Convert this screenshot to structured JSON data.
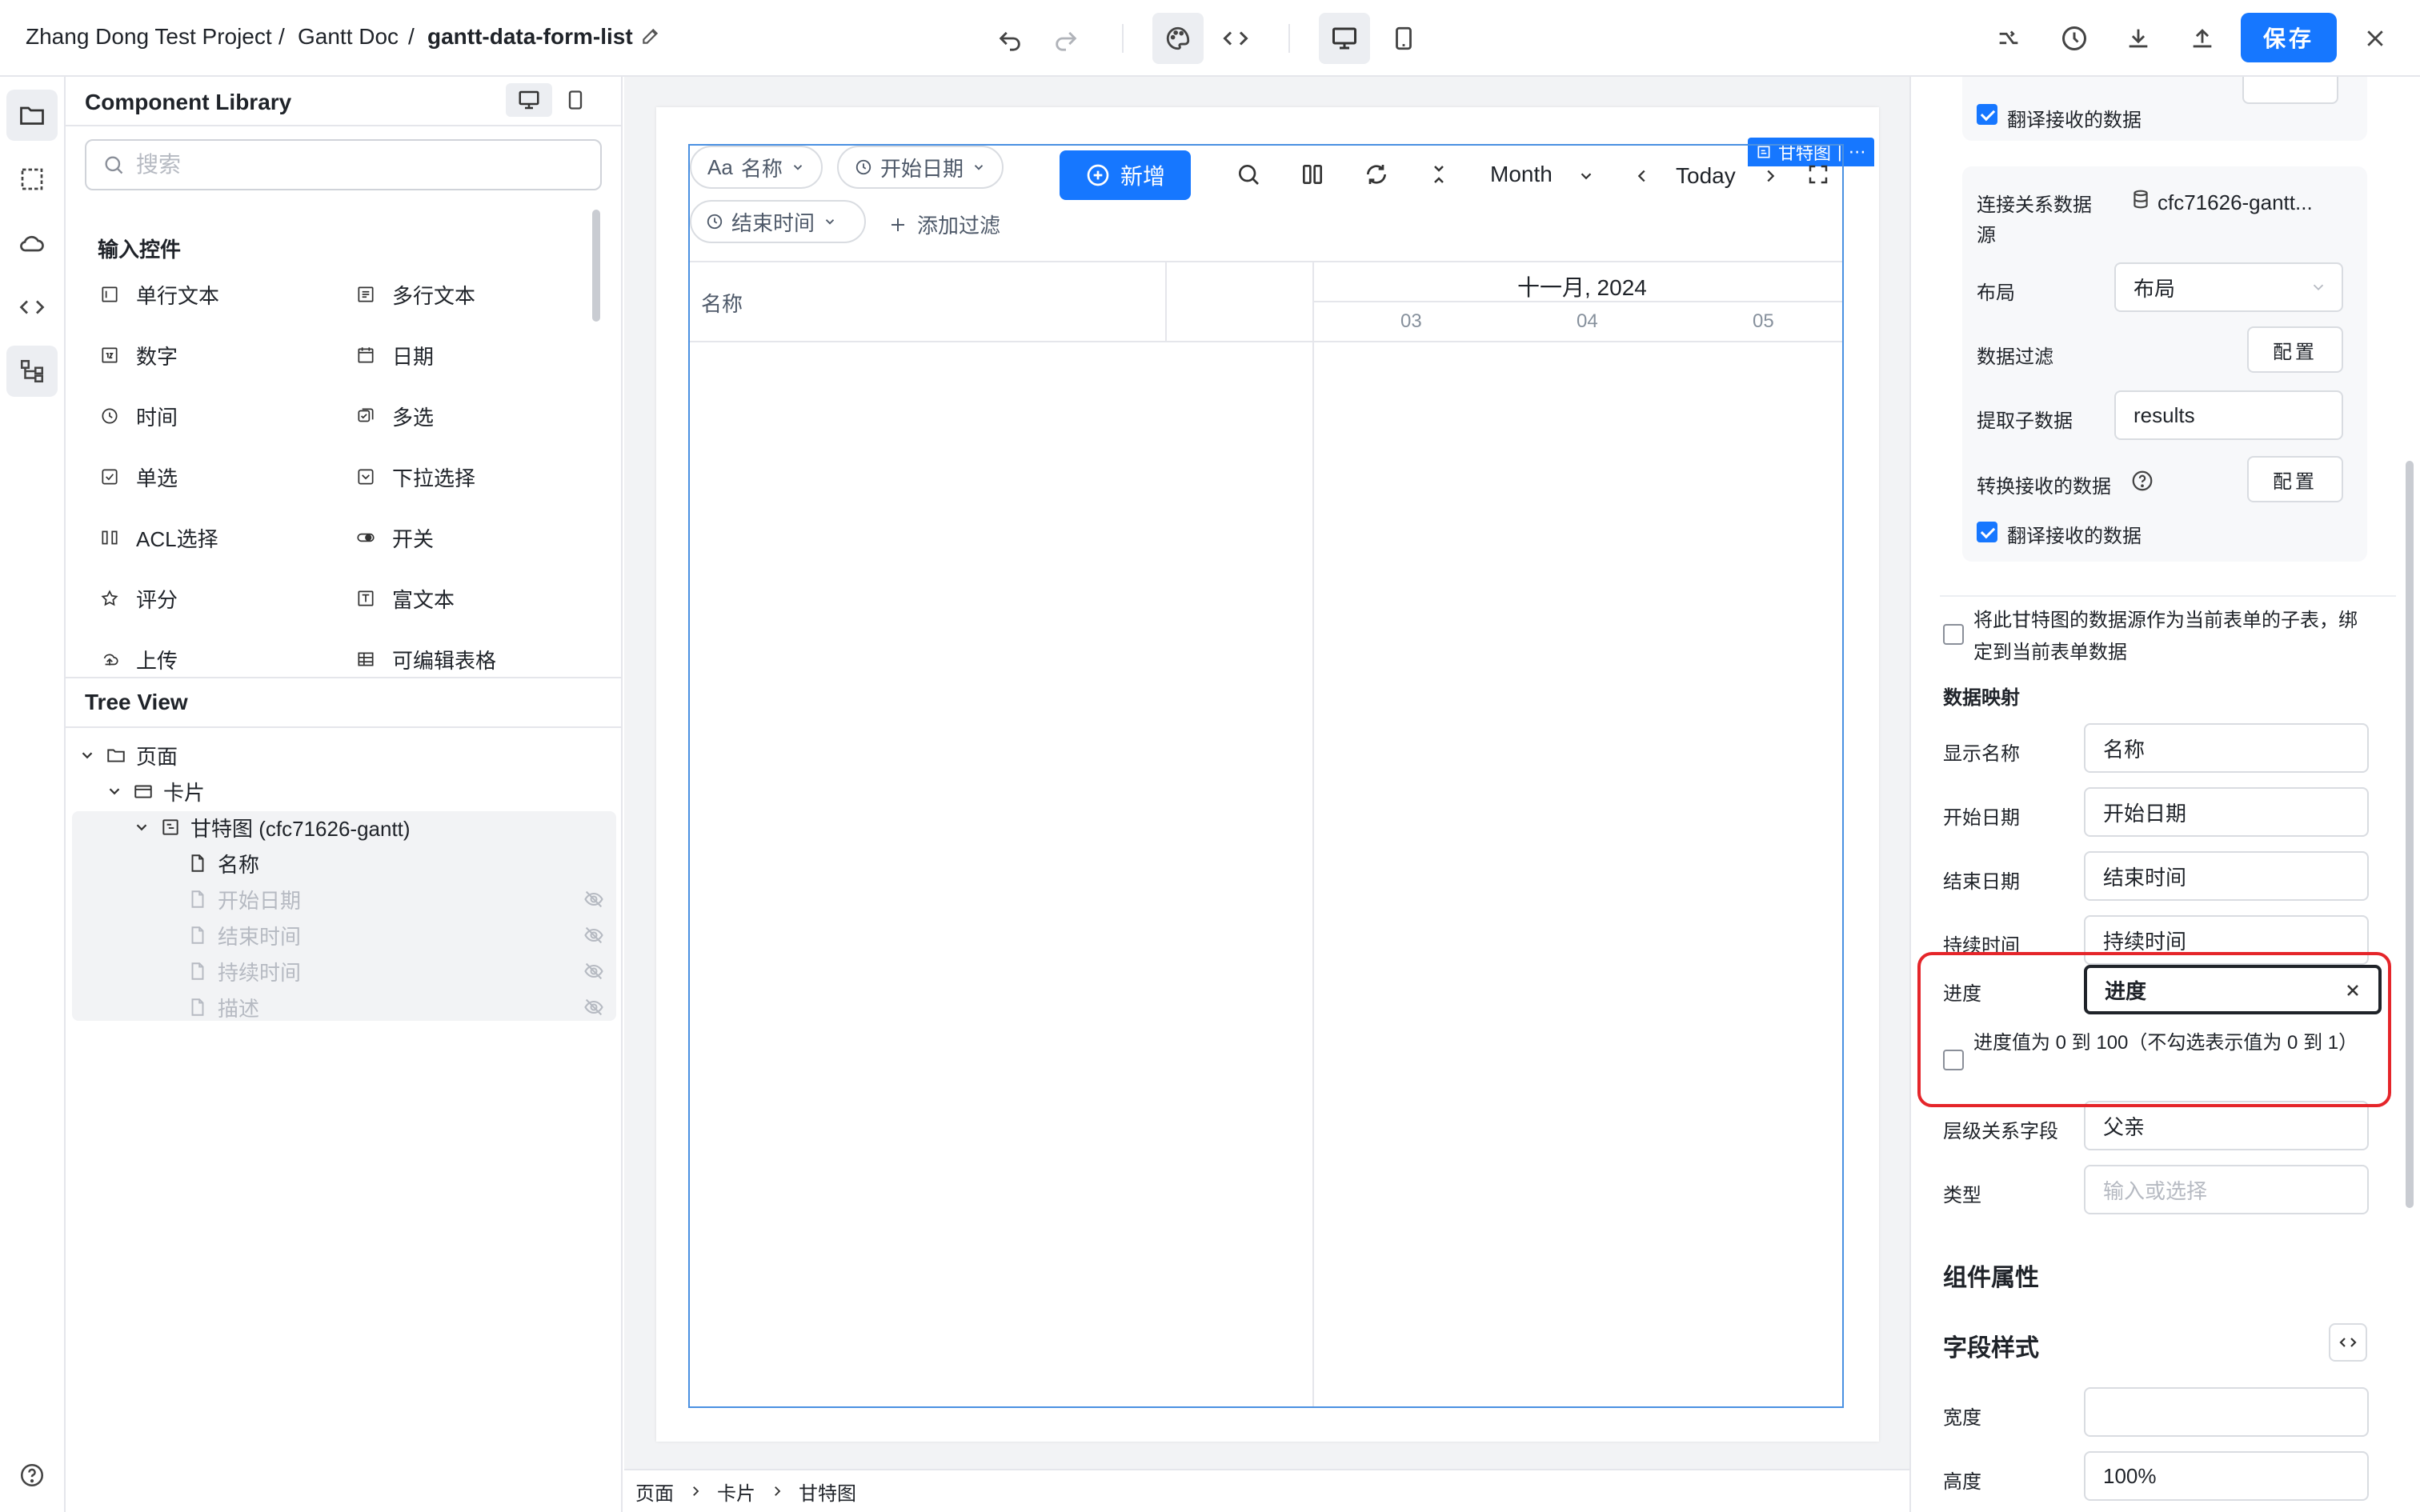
{
  "topbar": {
    "project": "Zhang Dong Test Project",
    "sep1": "/",
    "doc": "Gantt Doc",
    "sep2": "/",
    "page": "gantt-data-form-list",
    "save_label": "保存"
  },
  "library": {
    "title": "Component Library",
    "search_placeholder": "搜索",
    "group_title": "输入控件",
    "components": [
      {
        "label": "单行文本",
        "icon": "text-input-icon"
      },
      {
        "label": "多行文本",
        "icon": "textarea-icon"
      },
      {
        "label": "数字",
        "icon": "number-icon"
      },
      {
        "label": "日期",
        "icon": "calendar-icon"
      },
      {
        "label": "时间",
        "icon": "clock-icon"
      },
      {
        "label": "多选",
        "icon": "multi-select-icon"
      },
      {
        "label": "单选",
        "icon": "radio-icon"
      },
      {
        "label": "下拉选择",
        "icon": "dropdown-icon"
      },
      {
        "label": "ACL选择",
        "icon": "acl-icon"
      },
      {
        "label": "开关",
        "icon": "toggle-icon"
      },
      {
        "label": "评分",
        "icon": "star-icon"
      },
      {
        "label": "富文本",
        "icon": "richtext-icon"
      },
      {
        "label": "上传",
        "icon": "upload-icon"
      },
      {
        "label": "可编辑表格",
        "icon": "table-icon"
      }
    ]
  },
  "tree": {
    "title": "Tree View",
    "nodes": [
      {
        "label": "页面",
        "hidden": false
      },
      {
        "label": "卡片",
        "hidden": false
      },
      {
        "label": "甘特图 (cfc71626-gantt)",
        "hidden": false
      },
      {
        "label": "名称",
        "hidden": false
      },
      {
        "label": "开始日期",
        "hidden": true
      },
      {
        "label": "结束时间",
        "hidden": true
      },
      {
        "label": "持续时间",
        "hidden": true
      },
      {
        "label": "描述",
        "hidden": true
      }
    ]
  },
  "gantt": {
    "tag": "甘特图",
    "chip_name": "名称",
    "chip_name_prefix": "Aa",
    "chip_start": "开始日期",
    "chip_end": "结束时间",
    "add_filter": "添加过滤",
    "add_button": "新增",
    "view_mode": "Month",
    "today": "Today",
    "name_col": "名称",
    "month_header": "十一月, 2024",
    "days": [
      "03",
      "04",
      "05"
    ]
  },
  "bottom_breadcrumb": [
    "页面",
    "卡片",
    "甘特图"
  ],
  "props": {
    "translate_label_top": "翻译接收的数据",
    "rel_source_label": "连接关系数据源",
    "rel_source_value": "cfc71626-gantt...",
    "layout_label": "布局",
    "layout_value": "布局",
    "filter_label": "数据过滤",
    "config_label": "配置",
    "extract_label": "提取子数据",
    "extract_value": "results",
    "transform_label": "转换接收的数据",
    "translate_label": "翻译接收的数据",
    "subtable_label": "将此甘特图的数据源作为当前表单的子表，绑定到当前表单数据",
    "mapping_title": "数据映射",
    "mapping": [
      {
        "label": "显示名称",
        "value": "名称"
      },
      {
        "label": "开始日期",
        "value": "开始日期"
      },
      {
        "label": "结束日期",
        "value": "结束时间"
      },
      {
        "label": "持续时间",
        "value": "持续时间"
      }
    ],
    "progress_label": "进度",
    "progress_value": "进度",
    "progress_range_label": "进度值为 0 到 100（不勾选表示值为 0 到 1）",
    "parent_label": "层级关系字段",
    "parent_value": "父亲",
    "type_label": "类型",
    "type_placeholder": "输入或选择",
    "component_props_title": "组件属性",
    "field_style_title": "字段样式",
    "width_label": "宽度",
    "width_value": "",
    "height_label": "高度",
    "height_value": "100%"
  },
  "colors": {
    "accent": "#1677ff",
    "highlight": "#e5252a"
  }
}
